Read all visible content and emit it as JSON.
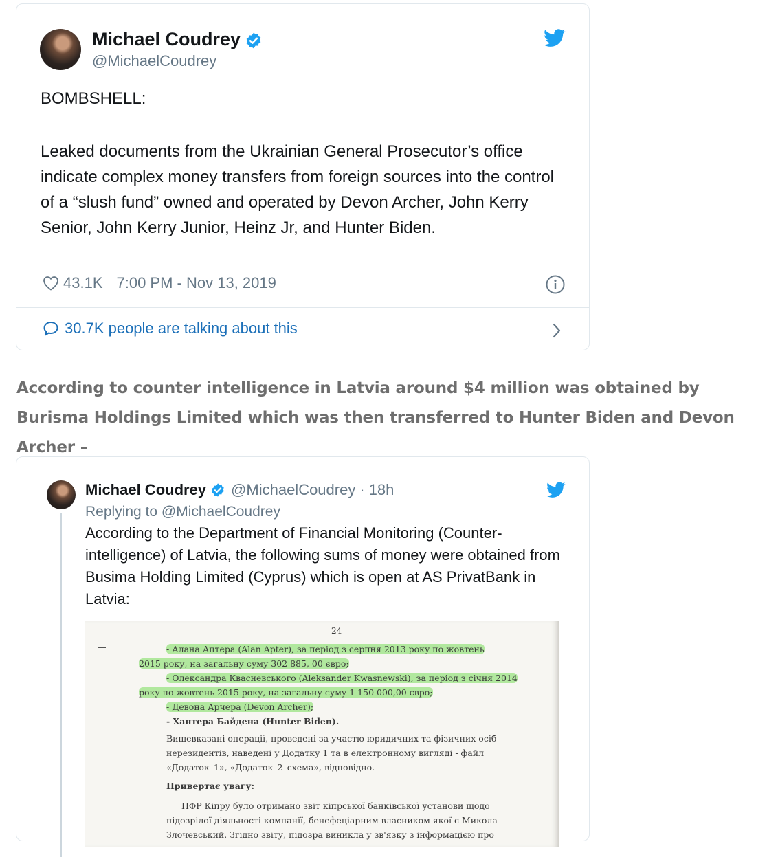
{
  "tweet1": {
    "name": "Michael Coudrey",
    "handle": "@MichaelCoudrey",
    "line1": "BOMBSHELL:",
    "body": "Leaked documents from the Ukrainian General Prosecutor’s office indicate complex money transfers from foreign sources into the control of a “slush fund” owned and operated by Devon Archer, John Kerry Senior, John Kerry Junior, Heinz Jr, and Hunter Biden.",
    "likes": "43.1K",
    "timestamp": "7:00 PM - Nov 13, 2019",
    "talking": "30.7K people are talking about this"
  },
  "article": {
    "text": "According to counter intelligence in Latvia around $4 million was obtained by Burisma Holdings Limited which was then transferred to Hunter Biden and Devon Archer –"
  },
  "tweet2": {
    "name": "Michael Coudrey",
    "handle": "@MichaelCoudrey",
    "separator": "·",
    "time": "18h",
    "replying": "Replying to @MichaelCoudrey",
    "body": "According to the Department of Financial Monitoring (Counter-intelligence) of Latvia, the following sums of money were obtained from Busima Holding Limited (Cyprus) which is open at AS PrivatBank in Latvia:",
    "document": {
      "page_number": "24",
      "lines": [
        "- Алана Аптера (Alan Apter), за період з серпня 2013 року по жовтень",
        "2015 року, на загальну суму 302 885, 00 євро;",
        "- Олександра Квасневського (Aleksander Kwasnewski), за період з січня 2014",
        "року по жовтень 2015 року, на загальну суму 1 150 000,00 євро;",
        "- Девона Арчера (Devon Archer);",
        "- Хантера Байдена (Hunter Biden).",
        "Вищевказані операції, проведені за участю юридичних та фізичних осіб-",
        "нерезидентів, наведені у Додатку 1 та в електронному вигляді - файл",
        "«Додаток_1», «Додаток_2_схема», відповідно.",
        "Привертає увагу:",
        "ПФР Кіпру було отримано звіт кіпрської банківської установи щодо",
        "підозрілої діяльності компанії, бенефеціарним власником якої є Микола",
        "Злочевський. Згідно звіту, підозра виникла у зв'язку з інформацією про"
      ]
    }
  },
  "colors": {
    "twitter_blue": "#1da1f2",
    "link_blue": "#1b6fb8",
    "gray_text": "#657786",
    "border": "#e1e8ed",
    "highlight": "#78dc5a"
  },
  "icons": [
    "twitter-bird-icon",
    "verified-badge-icon",
    "heart-icon",
    "info-icon",
    "speech-bubble-icon",
    "chevron-right-icon"
  ]
}
